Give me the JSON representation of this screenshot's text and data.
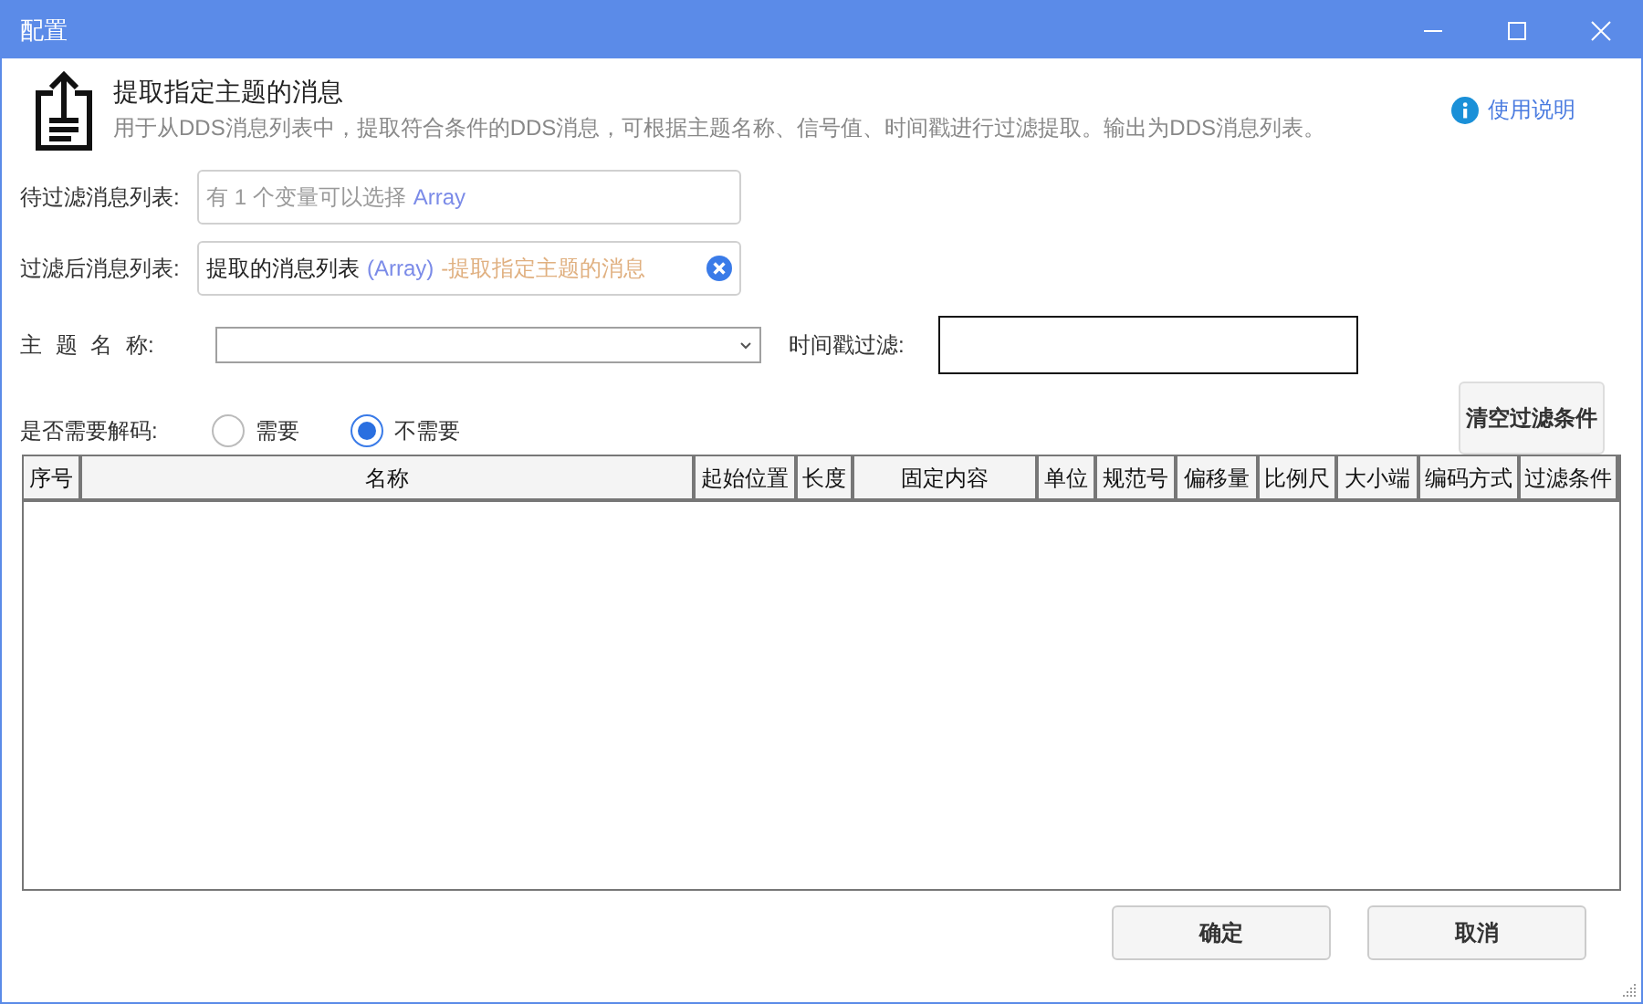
{
  "window": {
    "title": "配置"
  },
  "header": {
    "title": "提取指定主题的消息",
    "description": "用于从DDS消息列表中，提取符合条件的DDS消息，可根据主题名称、信号值、时间戳进行过滤提取。输出为DDS消息列表。",
    "help_link": "使用说明"
  },
  "input_list": {
    "label": "待过滤消息列表:",
    "placeholder": [
      {
        "kind": "plain",
        "text": "有 1 个变量可以选择"
      },
      {
        "kind": "type",
        "text": "Array"
      }
    ]
  },
  "output_list": {
    "label": "过滤后消息列表:",
    "value": [
      {
        "kind": "plain",
        "text": "提取的消息列表"
      },
      {
        "kind": "type",
        "text": "(Array)"
      },
      {
        "kind": "source",
        "text": "-提取指定主题的消息"
      }
    ]
  },
  "topic_name": {
    "label": "主 题 名 称:"
  },
  "timestamp_filter": {
    "label": "时间戳过滤:"
  },
  "decode": {
    "label": "是否需要解码:",
    "options": [
      {
        "label": "需要",
        "selected": false
      },
      {
        "label": "不需要",
        "selected": true
      }
    ]
  },
  "clear_button": "清空过滤条件",
  "table": {
    "columns": [
      "序号",
      "名称",
      "起始位置",
      "长度",
      "固定内容",
      "单位",
      "规范号",
      "偏移量",
      "比例尺",
      "大小端",
      "编码方式",
      "过滤条件"
    ]
  },
  "buttons": [
    "确定",
    "取消"
  ]
}
